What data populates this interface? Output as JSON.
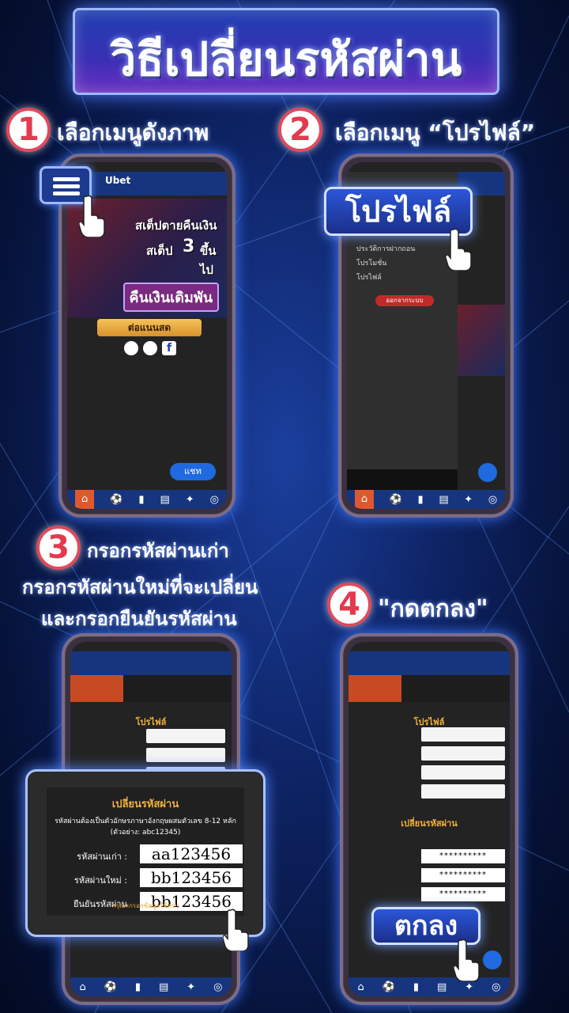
{
  "title": "วิธีเปลี่ยนรหัสผ่าน",
  "steps": [
    {
      "num": "1",
      "text": "เลือกเมนูดังภาพ"
    },
    {
      "num": "2",
      "text": "เลือกเมนู “โปรไฟล์”"
    },
    {
      "num": "3",
      "line1": "กรอกรหัสผ่านเก่า",
      "line2": "กรอกรหัสผ่านใหม่ที่จะเปลี่ยน",
      "line3": "และกรอกยืนยันรหัสผ่าน"
    },
    {
      "num": "4",
      "text": "\"กดตกลง\""
    }
  ],
  "callouts": {
    "profile": "โปรไฟล์",
    "ok": "ตกลง"
  },
  "phone1": {
    "logo": "Ubet",
    "banner_line1": "สเต็ปตายคืนเงิน",
    "banner_line2": "สเต็ป",
    "banner_num": "3",
    "banner_line3": "ขึ้นไป",
    "banner_cta": "คืนเงินเดิมพัน",
    "gold_button": "ต่อแนนสด",
    "chat": "แชท"
  },
  "phone2": {
    "drawer_items": [
      "ประวัติการฝากถอน",
      "โปรโมชั่น",
      "โปรไฟล์"
    ],
    "logout": "ออกจากระบบ"
  },
  "zoom": {
    "title": "เปลี่ยนรหัสผ่าน",
    "note_line1": "รหัสผ่านต้องเป็นตัวอักษรภาษาอังกฤษผสมตัวเลข 8-12 หลัก",
    "note_line2": "(ตัวอย่าง: abc12345)",
    "old_label": "รหัสผ่านเก่า :",
    "old_value": "aa123456",
    "new_label": "รหัสผ่านใหม่ :",
    "new_value": "bb123456",
    "confirm_label": "ยืนยันรหัสผ่าน",
    "confirm_value": "bb123456",
    "hint": "กรุณากรอกข้อมูลให้ครบ"
  },
  "phone4": {
    "form_title": "โปรไฟล์",
    "change_title": "เปลี่ยนรหัสผ่าน",
    "masked": "**********"
  }
}
